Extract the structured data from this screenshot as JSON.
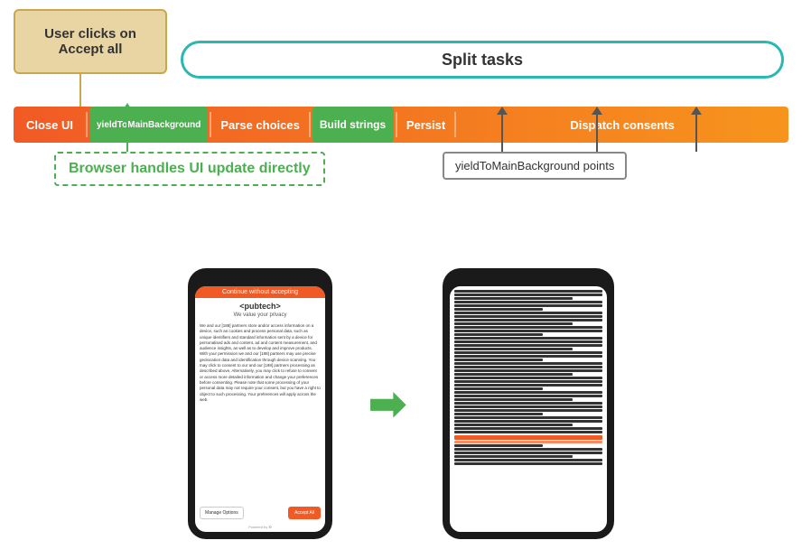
{
  "header": {
    "user_clicks_label": "User clicks on\nAccept all",
    "split_tasks_label": "Split tasks"
  },
  "flow": {
    "items": [
      {
        "label": "Close UI",
        "type": "orange"
      },
      {
        "label": "yieldToMainBackground",
        "type": "green"
      },
      {
        "label": "Parse choices",
        "type": "orange"
      },
      {
        "label": "Build strings",
        "type": "green"
      },
      {
        "label": "Persist",
        "type": "orange"
      },
      {
        "label": "Dispatch consents",
        "type": "orange"
      }
    ]
  },
  "annotations": {
    "browser_handles": "Browser handles UI update directly",
    "yield_points": "yieldToMainBackground  points"
  },
  "phone_left": {
    "header": "Continue without accepting",
    "brand": "<pubtech>",
    "subtitle": "We value your privacy",
    "body_text": "We and our [188] partners store and/or access information on a device, such as cookies and process personal data, such as unique identifiers and standard information sent by a device for personalised ads and content, ad and content measurement, and audience insights, as well as to develop and improve products. With your permission we and our [188] partners may use precise geolocation data and identification through device scanning. You may click to consent to our and our [188] partners processing as described above. Alternatively, you may click to refuse to consent or access more detailed information and change your preferences before consenting. Please note that some processing of your personal data may not require your consent, but you have a right to object to such processing. Your preferences will apply across the web.",
    "manage_btn": "Manage Options",
    "accept_btn": "Accept All",
    "powered": "Powered by"
  },
  "phone_right": {
    "content": "Lorem ipsum text document content"
  },
  "arrow": {
    "symbol": "➡"
  }
}
